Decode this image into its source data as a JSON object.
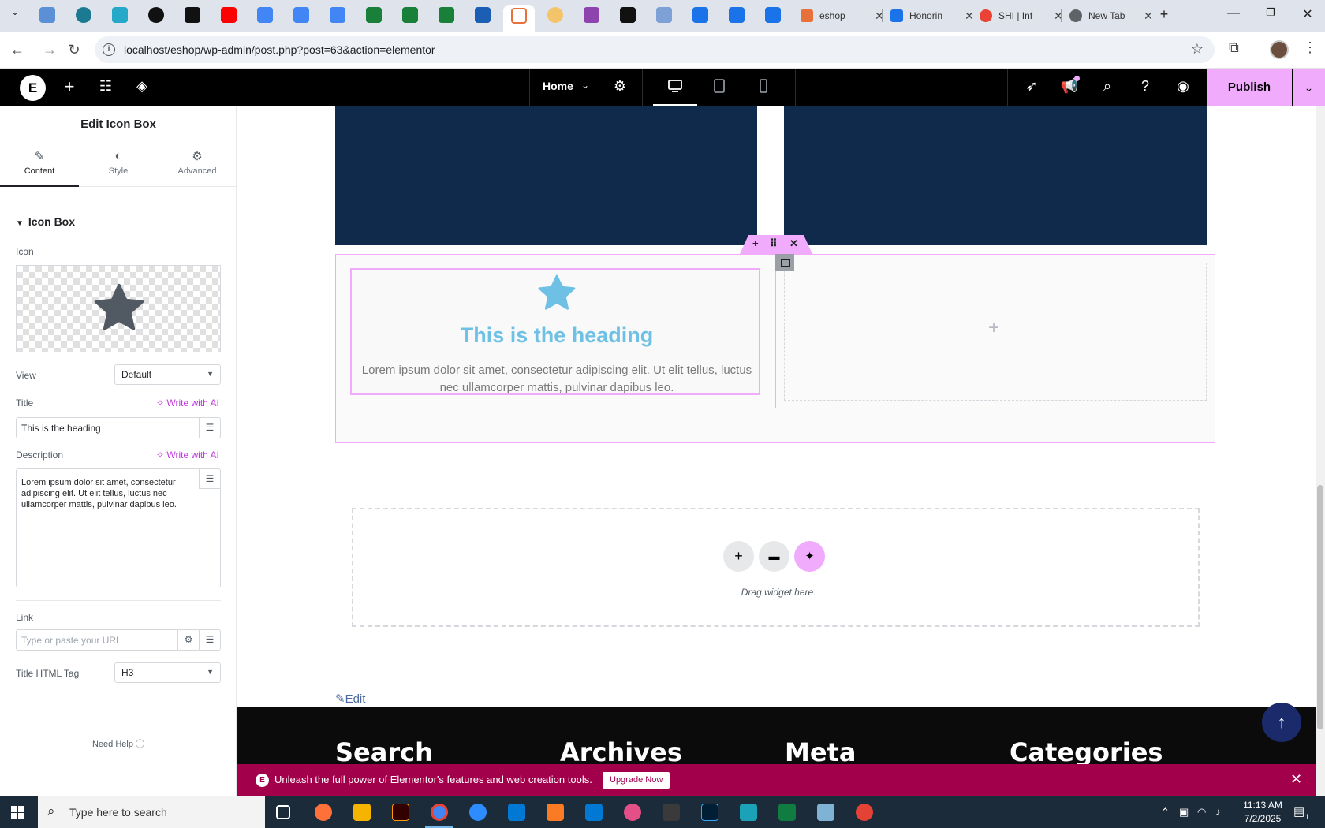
{
  "browser": {
    "tabs": [
      {
        "title": "eshop",
        "color": "#e8703a"
      },
      {
        "title": "Honorin",
        "color": "#1a73e8"
      },
      {
        "title": "SHI | Inf",
        "color": "#ea4335"
      },
      {
        "title": "New Tab",
        "color": "#5f6368"
      }
    ],
    "url": "localhost/eshop/wp-admin/post.php?post=63&action=elementor",
    "icons": [
      "back-icon",
      "forward-icon",
      "reload-icon",
      "info-icon",
      "bookmark-star-icon",
      "extensions-icon",
      "profile-avatar",
      "menu-icon"
    ]
  },
  "editor_bar": {
    "page_selector": "Home",
    "publish_label": "Publish",
    "accent": "#f0abfc"
  },
  "panel": {
    "title": "Edit Icon Box",
    "tabs": [
      {
        "label": "Content",
        "icon": "pencil-icon"
      },
      {
        "label": "Style",
        "icon": "contrast-icon"
      },
      {
        "label": "Advanced",
        "icon": "gear-icon"
      }
    ],
    "section": "Icon Box",
    "icon_label": "Icon",
    "view_label": "View",
    "view_value": "Default",
    "title_label": "Title",
    "write_ai": "Write with AI",
    "title_value": "This is the heading",
    "description_label": "Description",
    "description_value": "Lorem ipsum dolor sit amet, consectetur adipiscing elit. Ut elit tellus, luctus nec ullamcorper mattis, pulvinar dapibus leo.",
    "link_label": "Link",
    "link_placeholder": "Type or paste your URL",
    "title_tag_label": "Title HTML Tag",
    "title_tag_value": "H3",
    "need_help": "Need Help"
  },
  "canvas": {
    "icon_box": {
      "heading": "This is the heading",
      "description": "Lorem ipsum dolor sit amet, consectetur adipiscing elit. Ut elit tellus, luctus nec ullamcorper mattis, pulvinar dapibus leo.",
      "heading_color": "#6ec1e4"
    },
    "drop_hint": "Drag widget here",
    "edit_link": "Edit",
    "footer_headings": [
      "Search",
      "Archives",
      "Meta",
      "Categories"
    ],
    "promo_text": "Unleash the full power of Elementor's features and web creation tools.",
    "promo_button": "Upgrade Now",
    "navy_color": "#0f2a4a",
    "promo_color": "#a3004c"
  },
  "taskbar": {
    "search_placeholder": "Type here to search",
    "time": "11:13 AM",
    "date": "7/2/2025",
    "notification_count": "1"
  }
}
